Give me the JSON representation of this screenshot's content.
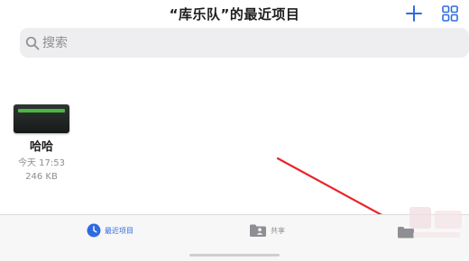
{
  "header": {
    "title": "“库乐队”的最近项目"
  },
  "search": {
    "placeholder": "搜索",
    "value": ""
  },
  "files": [
    {
      "name": "哈哈",
      "date": "今天 17:53",
      "size": "246 KB"
    }
  ],
  "tabs": [
    {
      "label": "最近项目",
      "icon": "clock-icon",
      "active": true
    },
    {
      "label": "共享",
      "icon": "shared-folder-icon",
      "active": false
    },
    {
      "label": "",
      "icon": "folder-icon",
      "active": false
    }
  ],
  "colors": {
    "accent": "#2f6be0",
    "annotation_arrow": "#e8262a",
    "thumbnail_strip": "#4cb640",
    "secondary_text": "#8e8e93"
  }
}
